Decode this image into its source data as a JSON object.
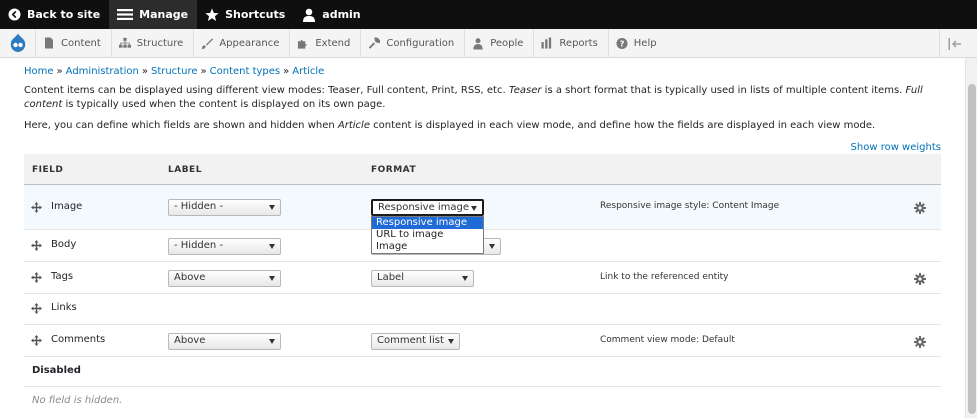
{
  "toolbar": {
    "back_to_site": "Back to site",
    "manage": "Manage",
    "shortcuts": "Shortcuts",
    "user": "admin"
  },
  "admin_menu": {
    "items": [
      "Content",
      "Structure",
      "Appearance",
      "Extend",
      "Configuration",
      "People",
      "Reports",
      "Help"
    ]
  },
  "breadcrumb": [
    "Home",
    "Administration",
    "Structure",
    "Content types",
    "Article"
  ],
  "intro": {
    "p1_a": "Content items can be displayed using different view modes: Teaser, Full content, Print, RSS, etc. ",
    "p1_teaser": "Teaser",
    "p1_b": " is a short format that is typically used in lists of multiple content items. ",
    "p1_full": "Full content",
    "p1_c": " is typically used when the content is displayed on its own page.",
    "p2_a": "Here, you can define which fields are shown and hidden when ",
    "p2_article": "Article",
    "p2_b": " content is displayed in each view mode, and define how the fields are displayed in each view mode."
  },
  "show_row_weights": "Show row weights",
  "table": {
    "headers": {
      "field": "FIELD",
      "label": "LABEL",
      "format": "FORMAT"
    },
    "rows": [
      {
        "name": "Image",
        "label": "- Hidden -",
        "format": "Responsive image",
        "summary": "Responsive image style: Content Image"
      },
      {
        "name": "Body",
        "label": "- Hidden -",
        "format": "",
        "summary": ""
      },
      {
        "name": "Tags",
        "label": "Above",
        "format": "Label",
        "summary": "Link to the referenced entity"
      },
      {
        "name": "Links",
        "label": "",
        "format": "",
        "summary": ""
      },
      {
        "name": "Comments",
        "label": "Above",
        "format": "Comment list",
        "summary": "Comment view mode: Default"
      }
    ],
    "disabled_label": "Disabled",
    "disabled_empty": "No field is hidden."
  },
  "format_dropdown": {
    "options": [
      "Responsive image",
      "URL to image",
      "Image"
    ],
    "selected": "Responsive image"
  },
  "colors": {
    "link": "#0071b8",
    "toolbar": "#0f0f0f",
    "highlight": "#1e6ad6"
  },
  "icons": [
    "back-icon",
    "manage-icon",
    "star-icon",
    "user-icon",
    "drupal-logo-icon",
    "content-icon",
    "structure-icon",
    "appearance-icon",
    "extend-icon",
    "configuration-icon",
    "people-icon",
    "reports-icon",
    "help-icon",
    "collapse-icon",
    "drag-handle-icon",
    "gear-icon"
  ]
}
